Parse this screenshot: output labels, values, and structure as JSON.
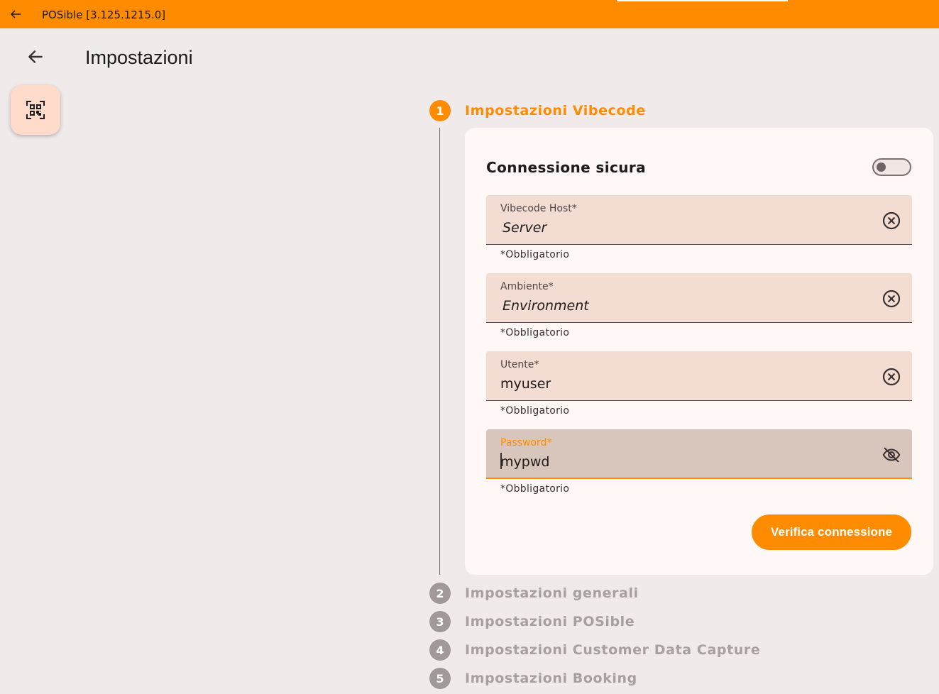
{
  "window": {
    "title": "POSible [3.125.1215.0]"
  },
  "header": {
    "title": "Impostazioni"
  },
  "steps": [
    {
      "number": "1",
      "label": "Impostazioni Vibecode"
    },
    {
      "number": "2",
      "label": "Impostazioni generali"
    },
    {
      "number": "3",
      "label": "Impostazioni POSible"
    },
    {
      "number": "4",
      "label": "Impostazioni Customer Data Capture"
    },
    {
      "number": "5",
      "label": "Impostazioni Booking"
    }
  ],
  "form": {
    "secure_label": "Connessione sicura",
    "secure_enabled": false,
    "fields": [
      {
        "label": "Vibecode Host*",
        "value": "Server",
        "helper": "*Obbligatorio"
      },
      {
        "label": "Ambiente*",
        "value": "Environment",
        "helper": "*Obbligatorio"
      },
      {
        "label": "Utente*",
        "value": "myuser",
        "helper": "*Obbligatorio"
      },
      {
        "label": "Password*",
        "value": "mypwd",
        "helper": "*Obbligatorio"
      }
    ],
    "verify_label": "Verifica connessione"
  },
  "colors": {
    "accent": "#ff8c00",
    "inactive_step": "#a19999",
    "card": "#fff8f6",
    "field": "#f3ddd3"
  }
}
